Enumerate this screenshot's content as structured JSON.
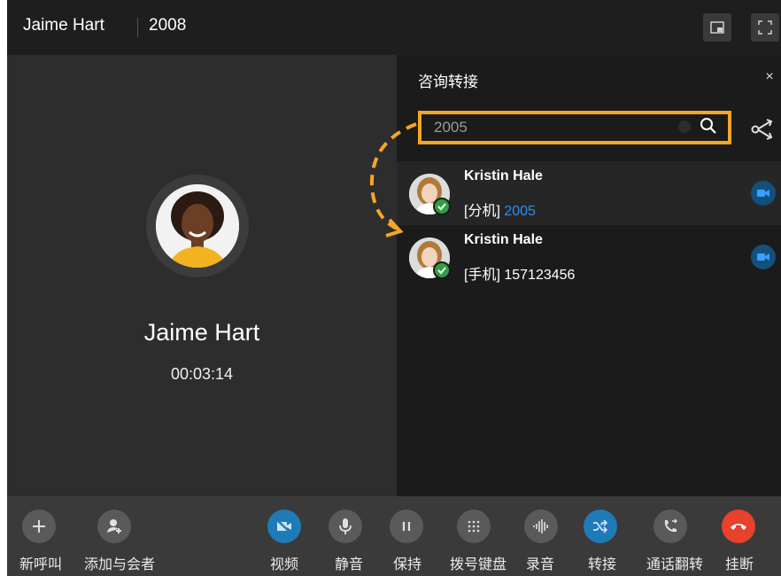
{
  "header": {
    "caller_name": "Jaime Hart",
    "extension": "2008"
  },
  "call": {
    "caller_name": "Jaime Hart",
    "duration": "00:03:14"
  },
  "panel": {
    "title": "咨询转接",
    "close": "×",
    "search": {
      "value": "2005",
      "placeholder": ""
    },
    "results": [
      {
        "name": "Kristin Hale",
        "label": "[分机]",
        "number": "2005",
        "status": "available"
      },
      {
        "name": "Kristin Hale",
        "label": "[手机]",
        "number": "157123456",
        "status": "available"
      }
    ]
  },
  "toolbar": {
    "new_call": "新呼叫",
    "add_participant": "添加与会者",
    "video": "视频",
    "mute": "静音",
    "hold": "保持",
    "dialpad": "拨号键盘",
    "record": "录音",
    "transfer": "转接",
    "flip": "通话翻转",
    "hangup": "挂断"
  },
  "colors": {
    "highlight": "#f5a623",
    "link_blue": "#2f8cf0",
    "hangup_red": "#e8412c",
    "available_green": "#2ea043"
  },
  "icons": [
    "picture-in-picture-icon",
    "fullscreen-icon",
    "search-icon",
    "share-icon",
    "video-icon",
    "plus-icon",
    "add-user-icon",
    "video-off-icon",
    "mic-icon",
    "pause-icon",
    "dialpad-icon",
    "waveform-icon",
    "transfer-icon",
    "phone-flip-icon",
    "hangup-icon"
  ]
}
